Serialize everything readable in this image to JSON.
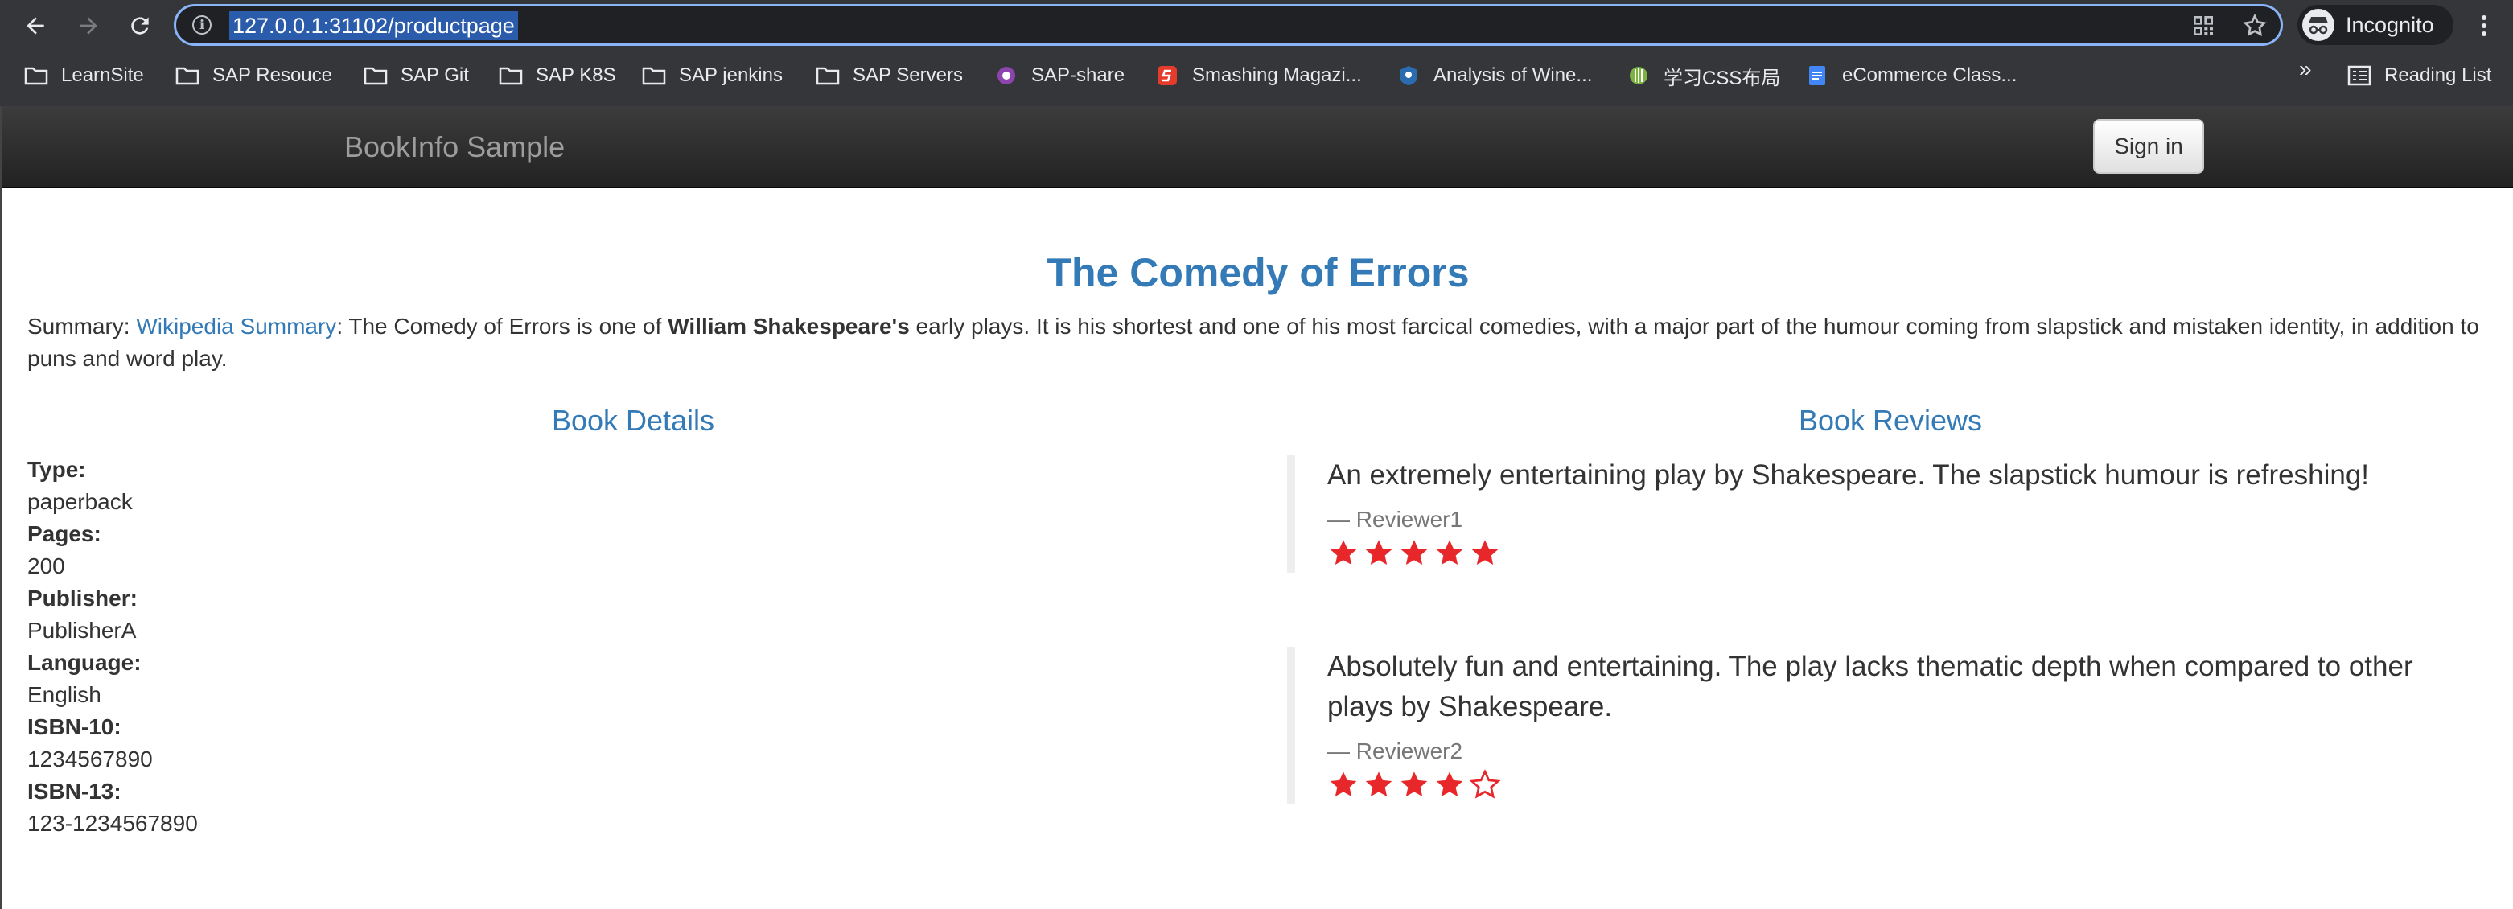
{
  "browser": {
    "url": "127.0.0.1:31102/productpage",
    "profile_label": "Incognito",
    "bookmarks": [
      {
        "label": "LearnSite",
        "icon": "folder-icon"
      },
      {
        "label": "SAP Resouce",
        "icon": "folder-icon"
      },
      {
        "label": "SAP Git",
        "icon": "folder-icon"
      },
      {
        "label": "SAP K8S",
        "icon": "folder-icon"
      },
      {
        "label": "SAP jenkins",
        "icon": "folder-icon"
      },
      {
        "label": "SAP Servers",
        "icon": "folder-icon"
      },
      {
        "label": "SAP-share",
        "icon": "sap-share-favicon"
      },
      {
        "label": "Smashing Magazi...",
        "icon": "smashing-favicon"
      },
      {
        "label": "Analysis of Wine...",
        "icon": "analysis-favicon"
      },
      {
        "label": "学习CSS布局",
        "icon": "css-layout-favicon"
      },
      {
        "label": "eCommerce Class...",
        "icon": "docs-favicon"
      }
    ],
    "more_label": "»",
    "reading_list_label": "Reading List"
  },
  "navbar": {
    "brand": "BookInfo Sample",
    "signin_label": "Sign in"
  },
  "product": {
    "title": "The Comedy of Errors",
    "summary_prefix": "Summary: ",
    "summary_link": "Wikipedia Summary",
    "summary_part1": ": The Comedy of Errors is one of ",
    "summary_bold": "William Shakespeare's",
    "summary_part2": " early plays. It is his shortest and one of his most farcical comedies, with a major part of the humour coming from slapstick and mistaken identity, in addition to puns and word play."
  },
  "details": {
    "heading": "Book Details",
    "rows": [
      {
        "label": "Type:",
        "value": "paperback"
      },
      {
        "label": "Pages:",
        "value": "200"
      },
      {
        "label": "Publisher:",
        "value": "PublisherA"
      },
      {
        "label": "Language:",
        "value": "English"
      },
      {
        "label": "ISBN-10:",
        "value": "1234567890"
      },
      {
        "label": "ISBN-13:",
        "value": "123-1234567890"
      }
    ]
  },
  "reviews": {
    "heading": "Book Reviews",
    "items": [
      {
        "text": "An extremely entertaining play by Shakespeare. The slapstick humour is refreshing!",
        "author": "— Reviewer1",
        "rating": 5,
        "max_rating": 5
      },
      {
        "text": "Absolutely fun and entertaining. The play lacks thematic depth when compared to other plays by Shakespeare.",
        "author": "— Reviewer2",
        "rating": 4,
        "max_rating": 5
      }
    ],
    "star_color": "#e8272b"
  },
  "colors": {
    "link": "#337ab7",
    "navbar": "#222222",
    "chrome": "#35363a"
  }
}
